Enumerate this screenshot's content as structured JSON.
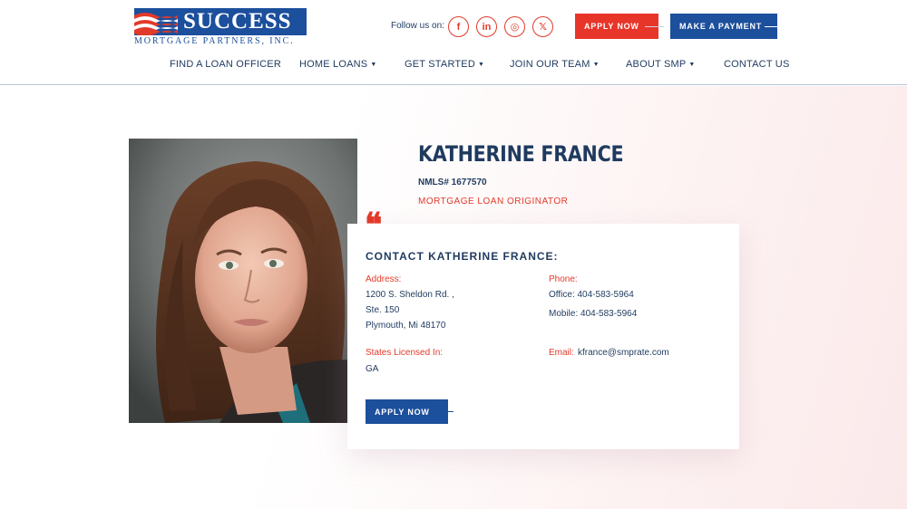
{
  "brand": {
    "name": "SUCCESS",
    "subtitle": "MORTGAGE PARTNERS, INC.",
    "primary_color": "#1c4f9c",
    "accent_color": "#e8352a"
  },
  "header": {
    "follow_label": "Follow us on:",
    "social": [
      {
        "name": "facebook-icon",
        "glyph": "f"
      },
      {
        "name": "linkedin-icon",
        "glyph": "in"
      },
      {
        "name": "instagram-icon",
        "glyph": "◎"
      },
      {
        "name": "x-icon",
        "glyph": "𝕏"
      }
    ],
    "apply_label": "APPLY NOW",
    "payment_label": "MAKE A PAYMENT"
  },
  "nav": {
    "items": [
      {
        "label": "FIND A LOAN OFFICER",
        "dropdown": false
      },
      {
        "label": "HOME LOANS",
        "dropdown": true
      },
      {
        "label": "GET STARTED",
        "dropdown": true
      },
      {
        "label": "JOIN OUR TEAM",
        "dropdown": true
      },
      {
        "label": "ABOUT SMP",
        "dropdown": true
      },
      {
        "label": "CONTACT US",
        "dropdown": false
      }
    ]
  },
  "profile": {
    "name": "KATHERINE FRANCE",
    "nmls": "NMLS# 1677570",
    "role": "MORTGAGE LOAN ORIGINATOR",
    "quote_glyph": "❝"
  },
  "contact": {
    "heading": "CONTACT KATHERINE FRANCE:",
    "address_label": "Address:",
    "address_lines": [
      "1200 S. Sheldon Rd. ,",
      "Ste. 150",
      "Plymouth, Mi 48170"
    ],
    "phone_label": "Phone:",
    "office": "Office: 404-583-5964",
    "mobile": "Mobile: 404-583-5964",
    "states_label": "States Licensed In:",
    "states": "GA",
    "email_label": "Email:",
    "email": "kfrance@smprate.com",
    "apply_label": "APPLY NOW"
  }
}
